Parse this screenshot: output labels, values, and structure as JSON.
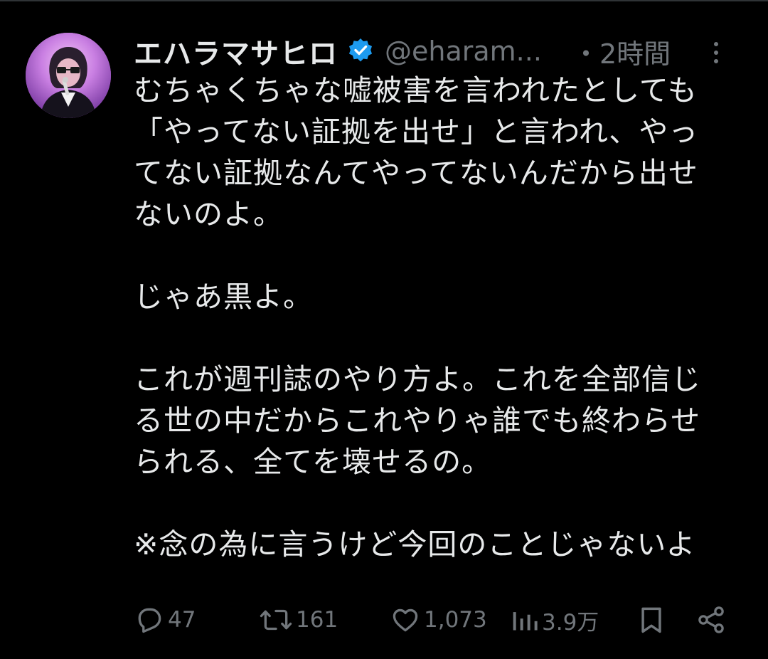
{
  "colors": {
    "background": "#000000",
    "text": "#e7e9ea",
    "secondary": "#71767b",
    "verified": "#1d9bf0"
  },
  "tweet": {
    "author": {
      "display_name": "エハラマサヒロ",
      "handle": "@eharam...",
      "verified_icon": "verified-badge-icon"
    },
    "timestamp": "・2時間",
    "body": {
      "paragraph1": [
        "むちゃくちゃな嘘被害を言われたとしても",
        "「やってない証拠を出せ」と言われ、やっ",
        "てない証拠なんてやってないんだから出せ",
        "ないのよ。"
      ],
      "paragraph2": [
        "じゃあ黒よ。"
      ],
      "paragraph3": [
        "これが週刊誌のやり方よ。これを全部信じ",
        "る世の中だからこれやりゃ誰でも終わらせ",
        "られる、全てを壊せるの。"
      ],
      "paragraph4": [
        "※念の為に言うけど今回のことじゃないよ"
      ]
    },
    "actions": {
      "reply": {
        "icon": "reply-icon",
        "count": "47"
      },
      "retweet": {
        "icon": "retweet-icon",
        "count": "161"
      },
      "like": {
        "icon": "heart-icon",
        "count": "1,073"
      },
      "views": {
        "icon": "views-icon",
        "count": "3.9万"
      },
      "bookmark": {
        "icon": "bookmark-icon"
      },
      "share": {
        "icon": "share-icon"
      }
    }
  }
}
